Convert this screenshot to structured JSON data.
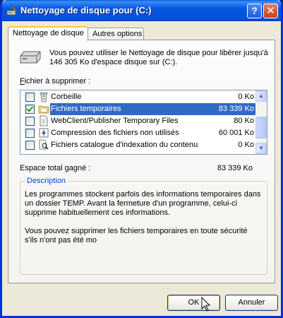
{
  "window": {
    "title": "Nettoyage de disque pour  (C:)",
    "help_label": "?",
    "close_label": "✕"
  },
  "tabs": [
    {
      "label": "Nettoyage de disque",
      "active": true
    },
    {
      "label": "Autres options",
      "active": false
    }
  ],
  "intro": "Vous pouvez utiliser le Nettoyage de disque pour libérer jusqu'à 146 305 Ko d'espace disque sur  (C:).",
  "files_label": "Fichier à supprimer :",
  "files": [
    {
      "name": "Corbeille",
      "size": "0 Ko",
      "checked": false,
      "selected": false,
      "icon": "recycle-bin-icon"
    },
    {
      "name": "Fichiers temporaires",
      "size": "83 339 Ko",
      "checked": true,
      "selected": true,
      "icon": "folder-icon"
    },
    {
      "name": "WebClient/Publisher Temporary Files",
      "size": "80 Ko",
      "checked": false,
      "selected": false,
      "icon": "document-icon"
    },
    {
      "name": "Compression des fichiers non utilisés",
      "size": "60 001 Ko",
      "checked": false,
      "selected": false,
      "icon": "compressed-icon"
    },
    {
      "name": "Fichiers catalogue d'indexation du contenu",
      "size": "0 Ko",
      "checked": false,
      "selected": false,
      "icon": "search-index-icon"
    }
  ],
  "total": {
    "label": "Espace total gagné :",
    "value": "83 339 Ko"
  },
  "description": {
    "title": "Description",
    "paragraphs": [
      "Les programmes stockent parfois des informations temporaires dans un dossier TEMP. Avant la fermeture d'un programme, celui-ci supprime habituellement ces informations.",
      "Vous pouvez supprimer les fichiers temporaires en toute sécurité s'ils n'ont pas été mo"
    ]
  },
  "buttons": {
    "ok": "OK",
    "cancel": "Annuler"
  },
  "colors": {
    "titlebar": "#0A5EDB",
    "selection": "#316AC5",
    "group_title": "#0046D5",
    "window_bg": "#ECE9D8"
  }
}
